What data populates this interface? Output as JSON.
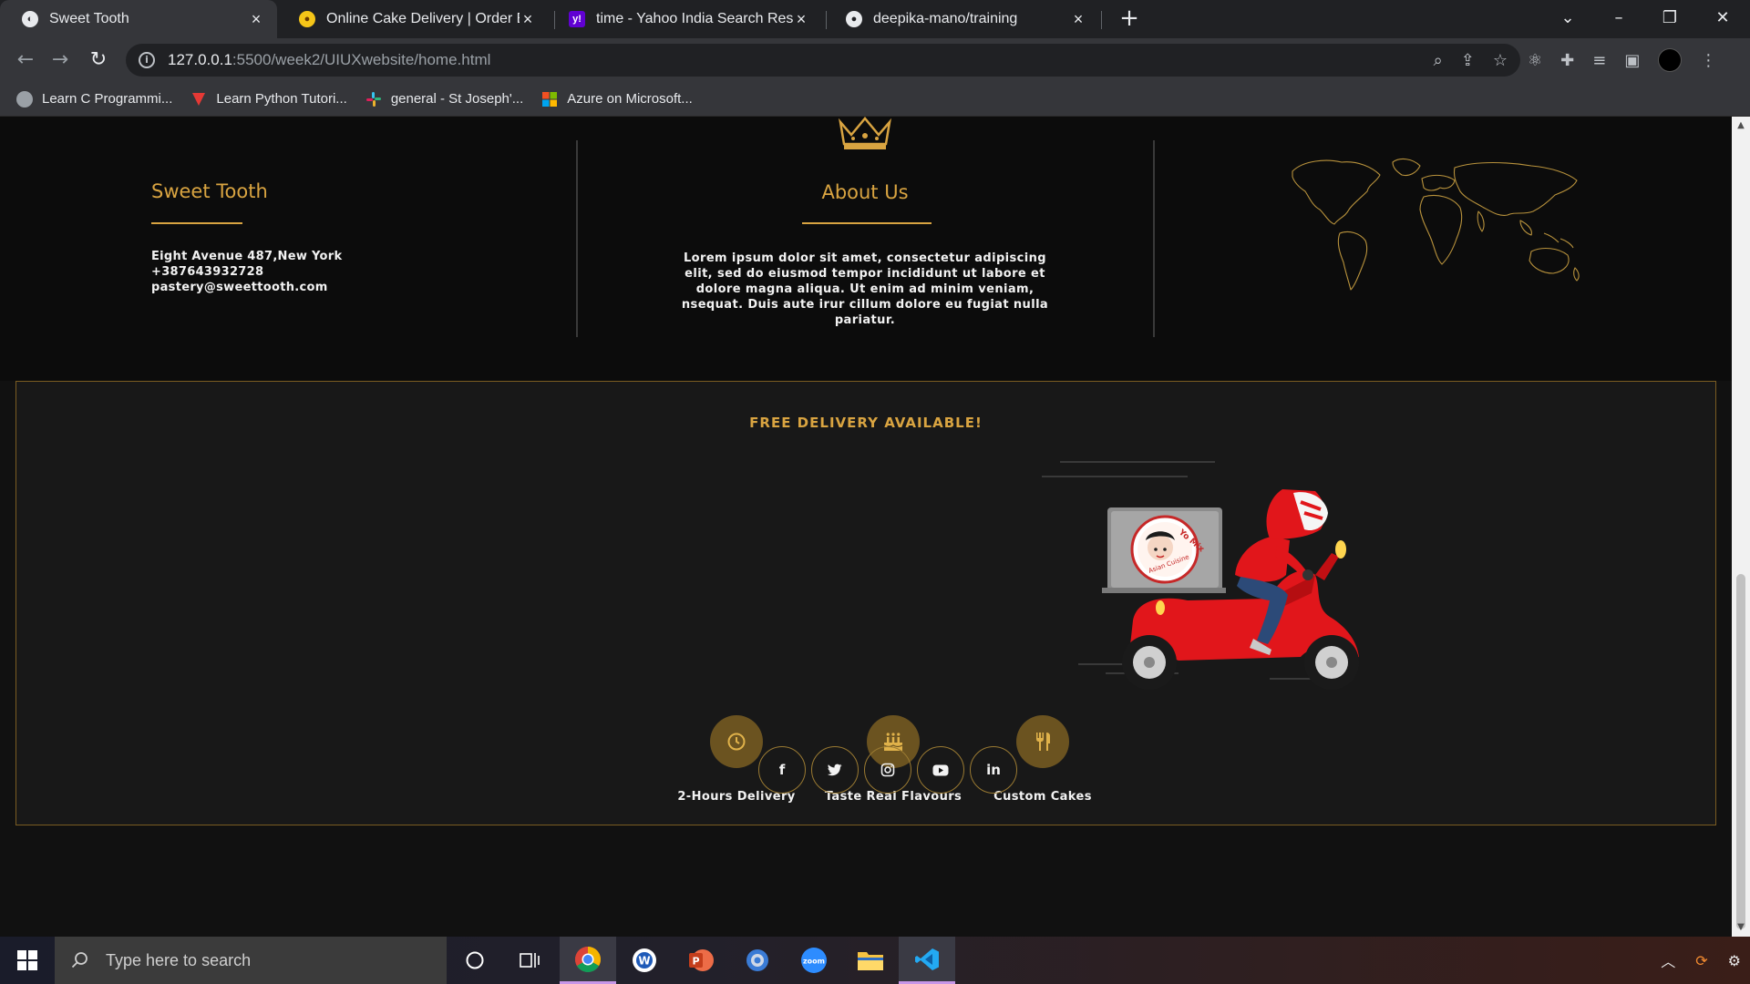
{
  "browser": {
    "tabs": [
      {
        "title": "Sweet Tooth",
        "active": true
      },
      {
        "title": "Online Cake Delivery | Order Best",
        "active": false
      },
      {
        "title": "time - Yahoo India Search Results",
        "active": false
      },
      {
        "title": "deepika-mano/training",
        "active": false
      }
    ],
    "url_host": "127.0.0.1",
    "url_path": ":5500/week2/UIUXwebsite/home.html",
    "bookmarks": [
      "Learn C Programmi...",
      "Learn Python Tutori...",
      "general - St Joseph'...",
      "Azure on Microsoft..."
    ]
  },
  "footer": {
    "brand": "Sweet Tooth",
    "address": "Eight Avenue 487,New York",
    "phone": "+387643932728",
    "email": "pastery@sweettooth.com",
    "about_title": "About Us",
    "about_text": "Lorem ipsum dolor sit amet, consectetur adipiscing elit, sed do eiusmod tempor incididunt ut labore et dolore magna aliqua. Ut enim ad minim veniam, nsequat. Duis aute irur cillum dolore eu fugiat nulla pariatur."
  },
  "delivery": {
    "title": "FREE DELIVERY AVAILABLE!",
    "box_logo_text": "Yo Mix Asian Cuisine",
    "features": [
      {
        "label": "2-Hours Delivery",
        "icon": "clock-icon"
      },
      {
        "label": "Taste Real Flavours",
        "icon": "cake-icon"
      },
      {
        "label": "Custom Cakes",
        "icon": "utensils-icon"
      }
    ]
  },
  "social": [
    {
      "label": "f",
      "icon": "facebook-icon"
    },
    {
      "label": "t",
      "icon": "twitter-icon"
    },
    {
      "label": "ig",
      "icon": "instagram-icon"
    },
    {
      "label": "▶",
      "icon": "youtube-icon"
    },
    {
      "label": "in",
      "icon": "linkedin-icon"
    }
  ],
  "taskbar": {
    "search_placeholder": "Type here to search"
  },
  "colors": {
    "gold": "#d9a441",
    "background": "#111111",
    "delivery_bg": "#181818",
    "feature_circle": "#6b5320",
    "scooter_red": "#e1161b"
  }
}
